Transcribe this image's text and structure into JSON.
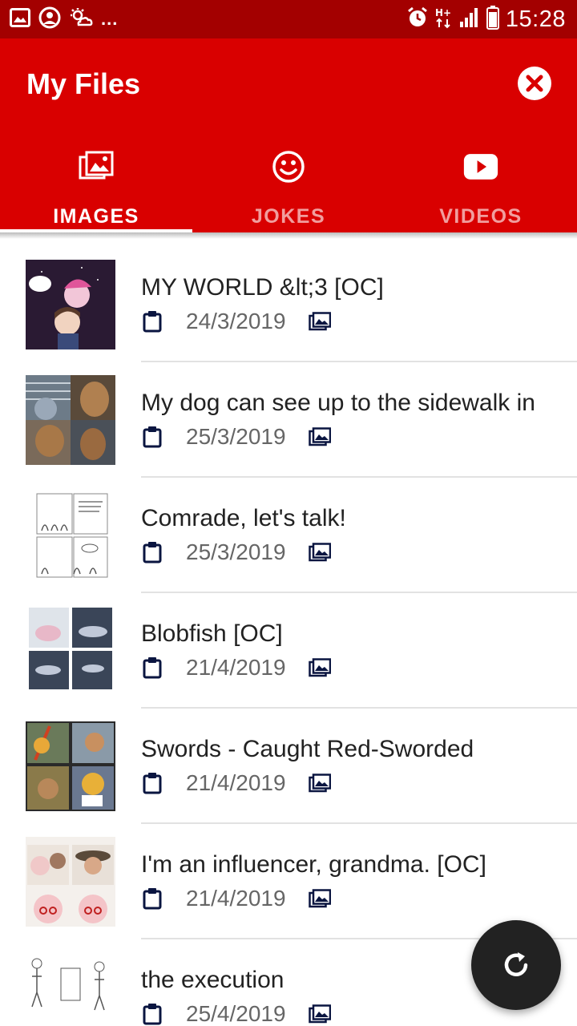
{
  "status_bar": {
    "time": "15:28",
    "overflow": "...",
    "left_icons": [
      "gallery-icon",
      "account-icon",
      "weather-icon"
    ],
    "right_icons": [
      "alarm-icon",
      "hplus-data-icon",
      "signal-icon",
      "battery-icon"
    ]
  },
  "app_bar": {
    "title": "My Files",
    "close_icon": "close-circle-icon",
    "color": "#d90000",
    "status_color": "#a30000"
  },
  "tabs": [
    {
      "label": "IMAGES",
      "icon": "images-icon",
      "selected": true
    },
    {
      "label": "JOKES",
      "icon": "smiley-icon",
      "selected": false
    },
    {
      "label": "VIDEOS",
      "icon": "youtube-icon",
      "selected": false
    }
  ],
  "files": [
    {
      "title": "MY WORLD &lt;3 [OC]",
      "date": "24/3/2019",
      "thumb": "dark-comic"
    },
    {
      "title": "My dog can see up to the sidewalk in",
      "date": "25/3/2019",
      "thumb": "dog-photo"
    },
    {
      "title": "Comrade, let's talk!",
      "date": "25/3/2019",
      "thumb": "white-comic"
    },
    {
      "title": "Blobfish [OC]",
      "date": "21/4/2019",
      "thumb": "blobfish-comic"
    },
    {
      "title": "Swords - Caught Red-Sworded",
      "date": "21/4/2019",
      "thumb": "swords-comic"
    },
    {
      "title": "I'm an influencer, grandma. [OC]",
      "date": "21/4/2019",
      "thumb": "grandma-comic"
    },
    {
      "title": "the execution",
      "date": "25/4/2019",
      "thumb": "sketch-comic"
    }
  ],
  "fab": {
    "icon": "refresh-icon"
  }
}
